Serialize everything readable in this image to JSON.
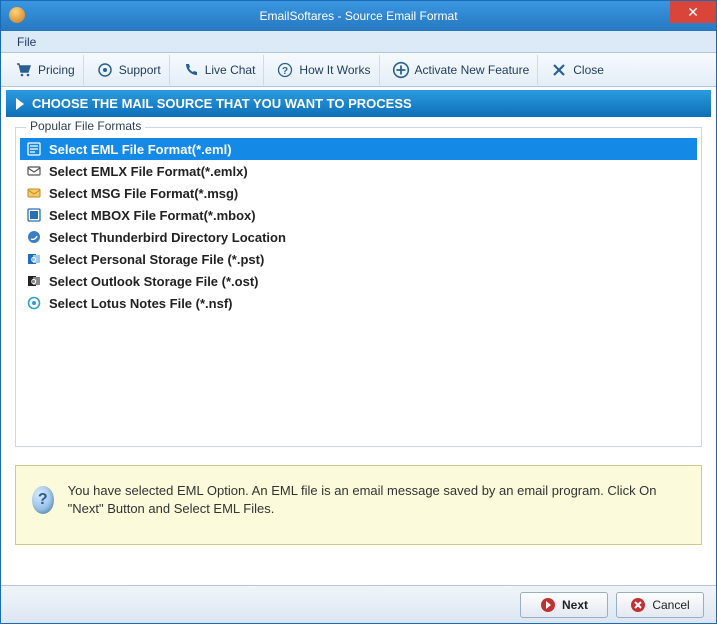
{
  "window": {
    "title": "EmailSoftares - Source Email Format"
  },
  "menubar": {
    "file": "File"
  },
  "toolbar": {
    "pricing": "Pricing",
    "support": "Support",
    "live_chat": "Live Chat",
    "how_it_works": "How It Works",
    "activate": "Activate New Feature",
    "close": "Close"
  },
  "header": {
    "title": "CHOOSE THE MAIL SOURCE THAT YOU WANT TO PROCESS"
  },
  "groupbox": {
    "title": "Popular File Formats"
  },
  "formats": [
    {
      "label": "Select EML File Format(*.eml)",
      "selected": true,
      "icon": "file-eml"
    },
    {
      "label": "Select EMLX File Format(*.emlx)",
      "selected": false,
      "icon": "file-emlx"
    },
    {
      "label": "Select MSG File Format(*.msg)",
      "selected": false,
      "icon": "file-msg"
    },
    {
      "label": "Select MBOX File Format(*.mbox)",
      "selected": false,
      "icon": "file-mbox"
    },
    {
      "label": "Select Thunderbird Directory Location",
      "selected": false,
      "icon": "thunderbird"
    },
    {
      "label": "Select Personal Storage File (*.pst)",
      "selected": false,
      "icon": "outlook-pst"
    },
    {
      "label": "Select Outlook Storage File (*.ost)",
      "selected": false,
      "icon": "outlook-ost"
    },
    {
      "label": "Select Lotus Notes File (*.nsf)",
      "selected": false,
      "icon": "lotus-notes"
    }
  ],
  "info": {
    "text": "You have selected EML Option. An EML file is an email message saved by an email program. Click On \"Next\" Button and Select EML Files."
  },
  "footer": {
    "next": "Next",
    "cancel": "Cancel"
  }
}
